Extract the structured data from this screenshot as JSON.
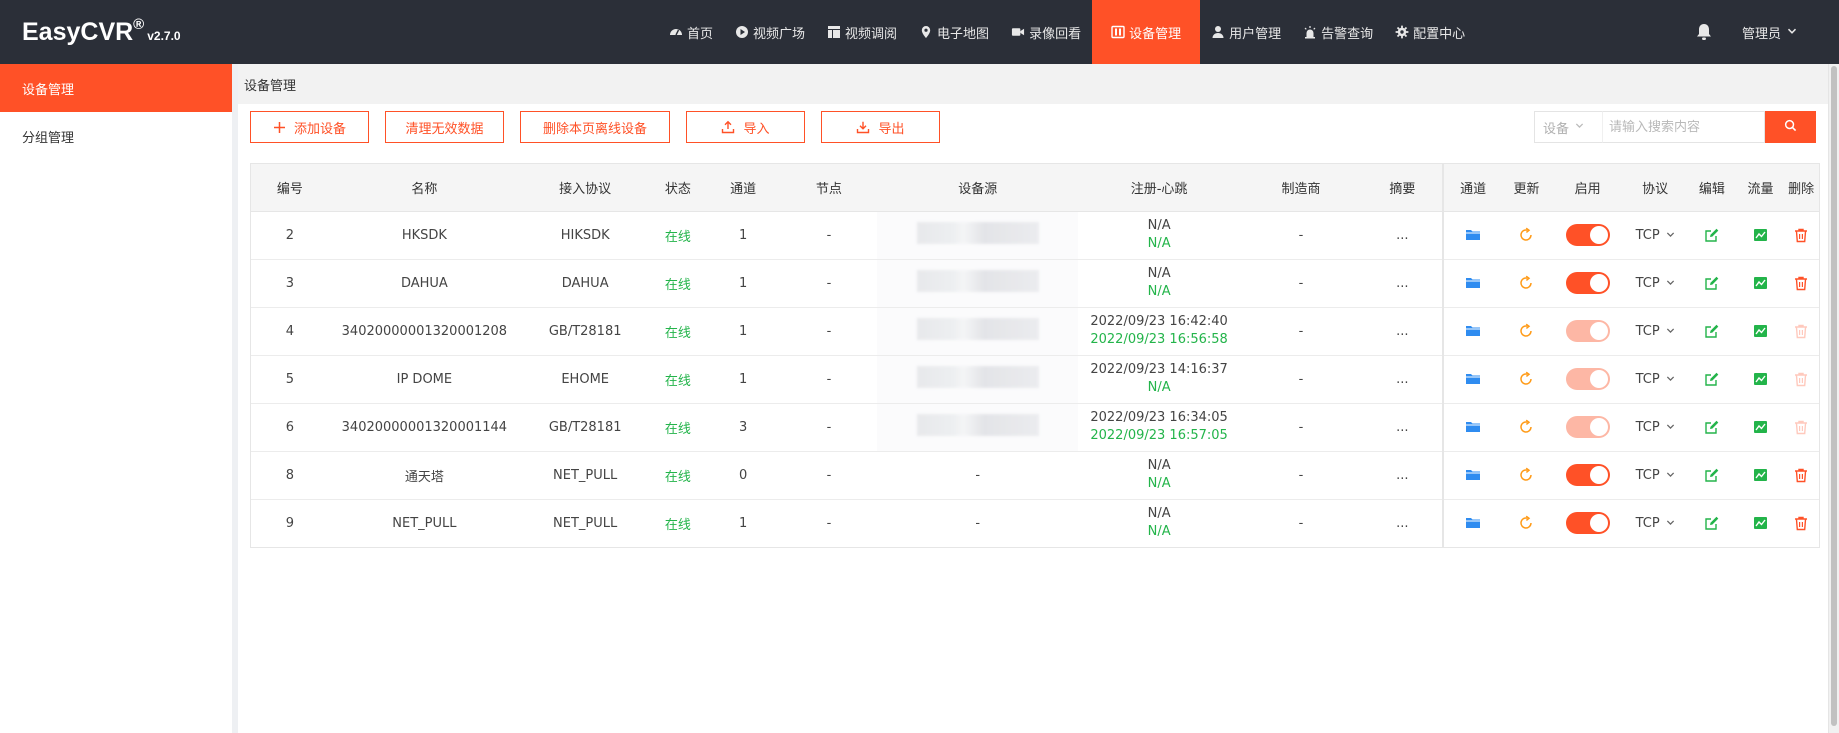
{
  "app": {
    "name": "EasyCVR",
    "reg": "®",
    "version": "v2.7.0"
  },
  "nav": [
    {
      "label": "首页",
      "icon": "dashboard-icon"
    },
    {
      "label": "视频广场",
      "icon": "play-circle-icon"
    },
    {
      "label": "视频调阅",
      "icon": "layout-icon"
    },
    {
      "label": "电子地图",
      "icon": "map-pin-icon"
    },
    {
      "label": "录像回看",
      "icon": "video-camera-icon"
    },
    {
      "label": "设备管理",
      "icon": "device-icon",
      "active": true
    },
    {
      "label": "用户管理",
      "icon": "user-icon"
    },
    {
      "label": "告警查询",
      "icon": "alarm-icon"
    },
    {
      "label": "配置中心",
      "icon": "gear-icon"
    }
  ],
  "user": {
    "name": "管理员"
  },
  "sidebar": {
    "items": [
      {
        "label": "设备管理"
      },
      {
        "label": "分组管理"
      }
    ]
  },
  "breadcrumb": "设备管理",
  "toolbar": {
    "add": "添加设备",
    "clean": "清理无效数据",
    "delete_offline": "删除本页离线设备",
    "import": "导入",
    "export": "导出"
  },
  "search": {
    "type": "设备",
    "placeholder": "请输入搜索内容"
  },
  "table": {
    "headers": [
      "编号",
      "名称",
      "接入协议",
      "状态",
      "通道",
      "节点",
      "设备源",
      "注册-心跳",
      "制造商",
      "摘要",
      "通道",
      "更新",
      "启用",
      "协议",
      "编辑",
      "流量",
      "删除"
    ],
    "rows": [
      {
        "id": "2",
        "name": "HKSDK",
        "proto": "HIKSDK",
        "status": "在线",
        "channels": "1",
        "node": "-",
        "source": "",
        "source_blur": true,
        "reg": "N/A",
        "heart": "N/A",
        "maker": "-",
        "summary": "...",
        "enabled": true,
        "transport": "TCP",
        "deletable": true
      },
      {
        "id": "3",
        "name": "DAHUA",
        "proto": "DAHUA",
        "status": "在线",
        "channels": "1",
        "node": "-",
        "source": "",
        "source_blur": true,
        "reg": "N/A",
        "heart": "N/A",
        "maker": "-",
        "summary": "...",
        "enabled": true,
        "transport": "TCP",
        "deletable": true
      },
      {
        "id": "4",
        "name": "34020000001320001208",
        "proto": "GB/T28181",
        "status": "在线",
        "channels": "1",
        "node": "-",
        "source": "",
        "source_blur": true,
        "reg": "2022/09/23 16:42:40",
        "heart": "2022/09/23 16:56:58",
        "maker": "-",
        "summary": "...",
        "enabled": false,
        "transport": "TCP",
        "deletable": false
      },
      {
        "id": "5",
        "name": "IP DOME",
        "proto": "EHOME",
        "status": "在线",
        "channels": "1",
        "node": "-",
        "source": "",
        "source_blur": true,
        "reg": "2022/09/23 14:16:37",
        "heart": "N/A",
        "maker": "-",
        "summary": "...",
        "enabled": false,
        "transport": "TCP",
        "deletable": false
      },
      {
        "id": "6",
        "name": "34020000001320001144",
        "proto": "GB/T28181",
        "status": "在线",
        "channels": "3",
        "node": "-",
        "source": "",
        "source_blur": true,
        "reg": "2022/09/23 16:34:05",
        "heart": "2022/09/23 16:57:05",
        "maker": "-",
        "summary": "...",
        "enabled": false,
        "transport": "TCP",
        "deletable": false
      },
      {
        "id": "8",
        "name": "通天塔",
        "proto": "NET_PULL",
        "status": "在线",
        "channels": "0",
        "node": "-",
        "source": "-",
        "source_blur": false,
        "reg": "N/A",
        "heart": "N/A",
        "maker": "-",
        "summary": "...",
        "enabled": true,
        "transport": "TCP",
        "deletable": true
      },
      {
        "id": "9",
        "name": "NET_PULL",
        "proto": "NET_PULL",
        "status": "在线",
        "channels": "1",
        "node": "-",
        "source": "-",
        "source_blur": false,
        "reg": "N/A",
        "heart": "N/A",
        "maker": "-",
        "summary": "...",
        "enabled": true,
        "transport": "TCP",
        "deletable": true
      }
    ]
  },
  "colors": {
    "accent": "#ff5127",
    "topbar": "#2b2f38",
    "online": "#23b44a",
    "folder": "#2f8cf0",
    "refresh": "#ff9b18",
    "edit": "#23b44a"
  }
}
